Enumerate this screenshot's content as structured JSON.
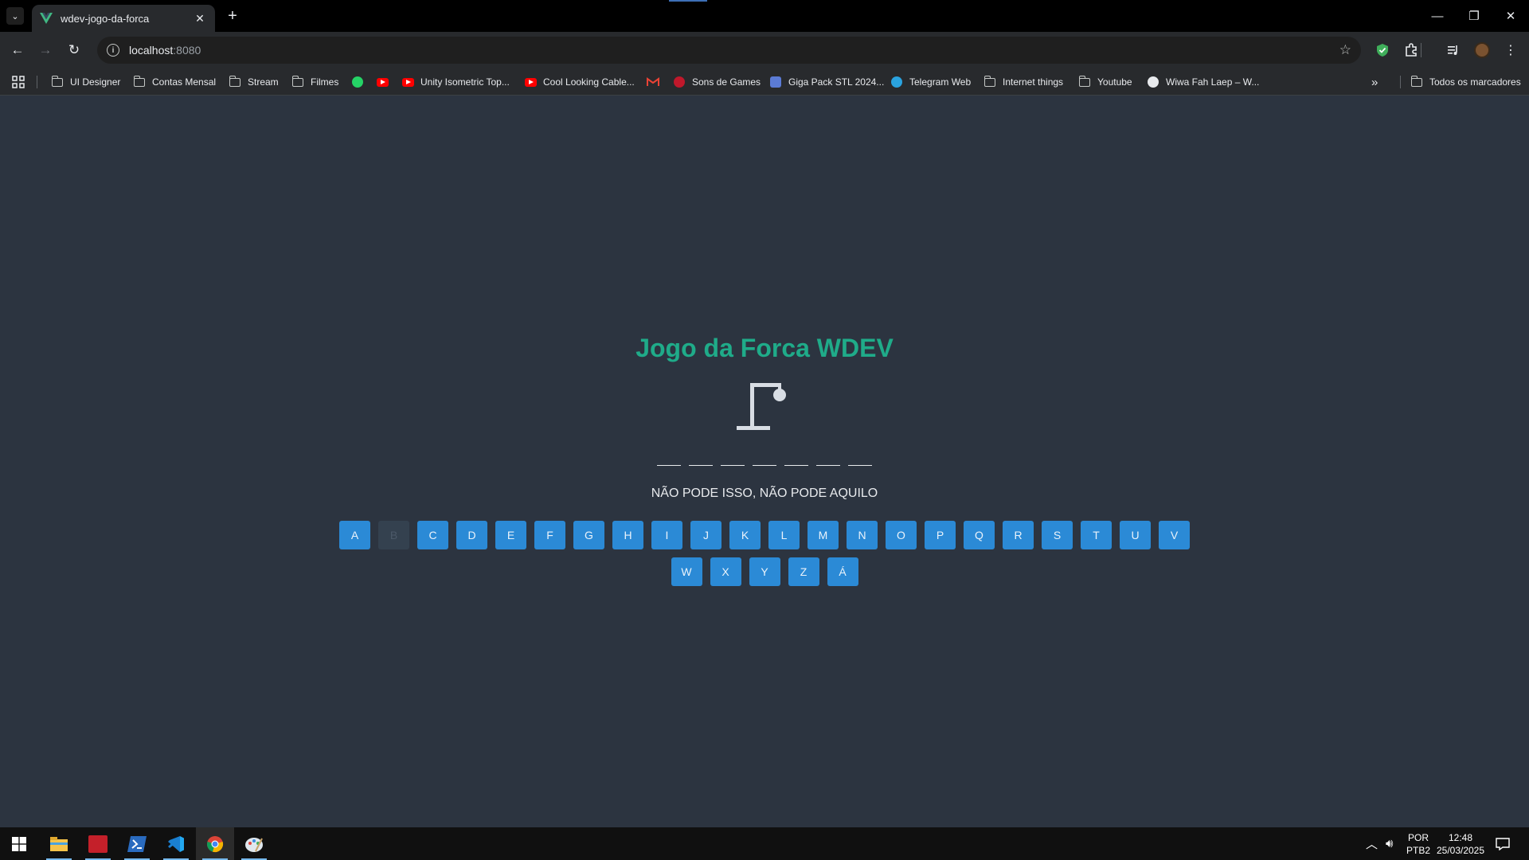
{
  "browser": {
    "tab_title": "wdev-jogo-da-forca",
    "url_host": "localhost",
    "url_port": ":8080",
    "bookmarks": [
      {
        "label": "UI Designer",
        "icon": "folder-icon"
      },
      {
        "label": "Contas Mensal",
        "icon": "folder-icon"
      },
      {
        "label": "Stream",
        "icon": "folder-icon"
      },
      {
        "label": "Filmes",
        "icon": "folder-icon"
      },
      {
        "label": "",
        "icon": "whatsapp-icon"
      },
      {
        "label": "",
        "icon": "youtube-icon"
      },
      {
        "label": "Unity Isometric Top...",
        "icon": "youtube-icon"
      },
      {
        "label": "Cool Looking Cable...",
        "icon": "youtube-icon"
      },
      {
        "label": "",
        "icon": "gmail-icon"
      },
      {
        "label": "Sons de Games",
        "icon": "red-site-icon"
      },
      {
        "label": "Giga Pack STL 2024...",
        "icon": "blue-site-icon"
      },
      {
        "label": "Telegram Web",
        "icon": "telegram-icon"
      },
      {
        "label": "Internet things",
        "icon": "folder-icon"
      },
      {
        "label": "Youtube",
        "icon": "folder-icon"
      },
      {
        "label": "Wiwa Fah Laep – W...",
        "icon": "globe-icon"
      }
    ],
    "all_bookmarks_label": "Todos os marcadores"
  },
  "game": {
    "title": "Jogo da Forca WDEV",
    "word_length": 7,
    "hint": "NÃO PODE ISSO, NÃO PODE AQUILO",
    "letters": [
      "A",
      "B",
      "C",
      "D",
      "E",
      "F",
      "G",
      "H",
      "I",
      "J",
      "K",
      "L",
      "M",
      "N",
      "O",
      "P",
      "Q",
      "R",
      "S",
      "T",
      "U",
      "V",
      "W",
      "X",
      "Y",
      "Z",
      "Á"
    ],
    "used_letters": [
      "B"
    ],
    "colors": {
      "title": "#1fab89",
      "key": "#2b8ad6",
      "key_used": "#34414f",
      "background": "#2c3440"
    }
  },
  "taskbar": {
    "language": "POR",
    "keyboard": "PTB2",
    "time": "12:48",
    "date": "25/03/2025"
  }
}
